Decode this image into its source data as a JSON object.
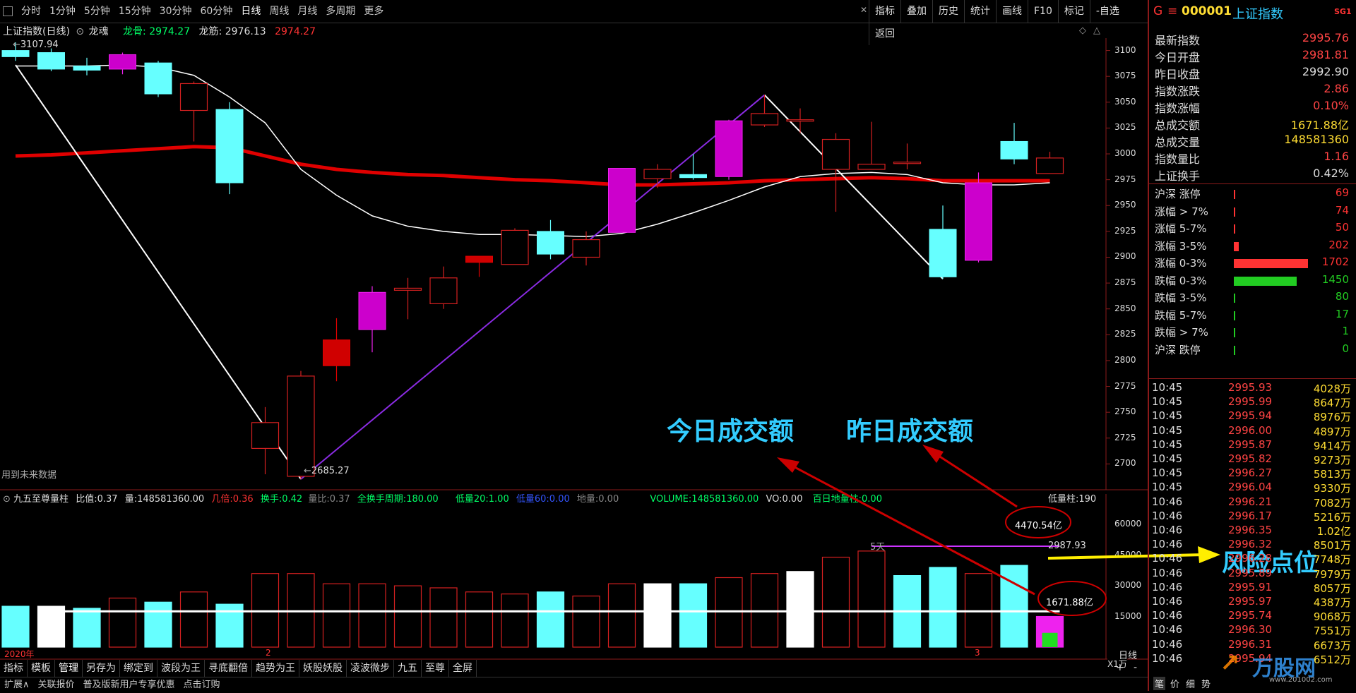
{
  "toolbar": {
    "periods": [
      "分时",
      "1分钟",
      "5分钟",
      "15分钟",
      "30分钟",
      "60分钟",
      "日线",
      "周线",
      "月线",
      "多周期",
      "更多"
    ],
    "active_period": "日线",
    "right_buttons": [
      "指标",
      "叠加",
      "历史",
      "统计",
      "画线",
      "F10",
      "标记",
      "-自选",
      "返回"
    ]
  },
  "chart_header": {
    "name": "上证指数(日线)",
    "indicator": "龙魂",
    "longgu_label": "龙骨",
    "longgu_value": "2974.27",
    "longjin_label": "龙筋",
    "longjin_value": "2976.13",
    "extra_value": "2974.27",
    "high_label": "3107.94",
    "low_label": "2685.27",
    "future_note": "用到未来数据"
  },
  "y_axis_top": [
    "3100",
    "3075",
    "3050",
    "3025",
    "3000",
    "2975",
    "2950",
    "2925",
    "2900",
    "2875",
    "2850",
    "2825",
    "2800",
    "2775",
    "2750",
    "2725",
    "2700"
  ],
  "sub_header": {
    "name": "九五至尊量柱",
    "ratio_label": "比值:",
    "ratio_value": "0.37",
    "vol_label": "量:",
    "vol_value": "148581360.00",
    "jibei_label": "几倍:",
    "jibei_value": "0.36",
    "huanshou_label": "换手:",
    "huanshou_value": "0.42",
    "liangbi_label": "量比:",
    "liangbi_value": "0.37",
    "qhs_label": "全换手周期:",
    "qhs_value": "180.00",
    "dl20_label": "低量20:",
    "dl20_value": "1.00",
    "dl60_label": "低量60:",
    "dl60_value": "0.00",
    "diliang_label": "地量:",
    "diliang_value": "0.00",
    "volume_label": "VOLUME:",
    "volume_value": "148581360.00",
    "vo_label": "VO:",
    "vo_value": "0.00",
    "bairi_label": "百日地量柱:",
    "bairi_value": "0.00",
    "diliangzhu_label": "低量柱:",
    "diliangzhu_value": "190"
  },
  "y_axis_sub": [
    "60000",
    "45000",
    "30000",
    "15000"
  ],
  "sub_unit": "X1万",
  "sub_annotations": {
    "five_day": "5天",
    "line_value": "2987.93",
    "yesterday_amount": "4470.54亿",
    "today_amount": "1671.88亿"
  },
  "x_axis": {
    "year": "2020年",
    "m2": "2",
    "m3": "3",
    "period_tag": "日线"
  },
  "annotations": {
    "today_amount": "今日成交额",
    "yesterday_amount": "昨日成交额",
    "risk": "风险点位"
  },
  "bottom_tabs": [
    "指标",
    "模板",
    "管理",
    "另存为",
    "绑定到",
    "波段为王",
    "寻底翻倍",
    "趋势为王",
    "妖股妖股",
    "凌波微步",
    "九五",
    "至尊",
    "全屏"
  ],
  "status_bar": [
    "扩展∧",
    "关联报价",
    "普及版新用户专享优惠",
    "点击订购"
  ],
  "quote": {
    "market": "G",
    "code": "000001",
    "name": "上证指数",
    "badge": "SG1",
    "rows": [
      {
        "label": "最新指数",
        "value": "2995.76",
        "color": "#ff4444"
      },
      {
        "label": "今日开盘",
        "value": "2981.81",
        "color": "#ff4444"
      },
      {
        "label": "昨日收盘",
        "value": "2992.90",
        "color": "#dddddd"
      },
      {
        "label": "指数涨跌",
        "value": "2.86",
        "color": "#ff4444"
      },
      {
        "label": "指数涨幅",
        "value": "0.10%",
        "color": "#ff4444"
      },
      {
        "label": "总成交额",
        "value": "1671.88亿",
        "color": "#ffdd33"
      },
      {
        "label": "总成交量",
        "value": "148581360",
        "color": "#ffdd33"
      },
      {
        "label": "指数量比",
        "value": "1.16",
        "color": "#ff4444"
      },
      {
        "label": "上证换手",
        "value": "0.42%",
        "color": "#dddddd"
      }
    ]
  },
  "breadth": [
    {
      "label": "沪深 涨停",
      "count": "69",
      "fill": 0.02,
      "color": "#ff3333"
    },
    {
      "label": "涨幅 > 7%",
      "count": "74",
      "fill": 0.02,
      "color": "#ff3333"
    },
    {
      "label": "涨幅 5-7%",
      "count": "50",
      "fill": 0.015,
      "color": "#ff3333"
    },
    {
      "label": "涨幅 3-5%",
      "count": "202",
      "fill": 0.07,
      "color": "#ff3333"
    },
    {
      "label": "涨幅 0-3%",
      "count": "1702",
      "fill": 1.0,
      "color": "#ff3333"
    },
    {
      "label": "跌幅 0-3%",
      "count": "1450",
      "fill": 0.85,
      "color": "#22cc22"
    },
    {
      "label": "跌幅 3-5%",
      "count": "80",
      "fill": 0.02,
      "color": "#22cc22"
    },
    {
      "label": "跌幅 5-7%",
      "count": "17",
      "fill": 0.005,
      "color": "#22cc22"
    },
    {
      "label": "跌幅 > 7%",
      "count": "1",
      "fill": 0.002,
      "color": "#22cc22"
    },
    {
      "label": "沪深 跌停",
      "count": "0",
      "fill": 0.0,
      "color": "#22cc22"
    }
  ],
  "ticks": [
    {
      "time": "10:45",
      "price": "2995.93",
      "vol": "4028万"
    },
    {
      "time": "10:45",
      "price": "2995.99",
      "vol": "8647万"
    },
    {
      "time": "10:45",
      "price": "2995.94",
      "vol": "8976万"
    },
    {
      "time": "10:45",
      "price": "2996.00",
      "vol": "4897万"
    },
    {
      "time": "10:45",
      "price": "2995.87",
      "vol": "9414万"
    },
    {
      "time": "10:45",
      "price": "2995.82",
      "vol": "9273万"
    },
    {
      "time": "10:45",
      "price": "2996.27",
      "vol": "5813万"
    },
    {
      "time": "10:45",
      "price": "2996.04",
      "vol": "9330万"
    },
    {
      "time": "10:46",
      "price": "2996.21",
      "vol": "7082万"
    },
    {
      "time": "10:46",
      "price": "2996.17",
      "vol": "5216万"
    },
    {
      "time": "10:46",
      "price": "2996.35",
      "vol": "1.02亿"
    },
    {
      "time": "10:46",
      "price": "2996.32",
      "vol": "8501万"
    },
    {
      "time": "10:46",
      "price": "2996.28",
      "vol": "7748万"
    },
    {
      "time": "10:46",
      "price": "2995.89",
      "vol": "7979万"
    },
    {
      "time": "10:46",
      "price": "2995.91",
      "vol": "8057万"
    },
    {
      "time": "10:46",
      "price": "2995.97",
      "vol": "4387万"
    },
    {
      "time": "10:46",
      "price": "2995.74",
      "vol": "9068万"
    },
    {
      "time": "10:46",
      "price": "2996.30",
      "vol": "7551万"
    },
    {
      "time": "10:46",
      "price": "2996.31",
      "vol": "6673万"
    },
    {
      "time": "10:46",
      "price": "2995.94",
      "vol": "6512万"
    }
  ],
  "watermark": "万股网",
  "watermark_url": "www.201002.com",
  "corner_tabs": [
    "笔",
    "价",
    "细",
    "势"
  ],
  "chart_data": {
    "type": "candlestick",
    "candles": [
      {
        "o": 3100,
        "h": 3107.94,
        "l": 3090,
        "c": 3094
      },
      {
        "o": 3098,
        "h": 3102,
        "l": 3080,
        "c": 3082
      },
      {
        "o": 3085,
        "h": 3093,
        "l": 3076,
        "c": 3081
      },
      {
        "o": 3082,
        "h": 3098,
        "l": 3077,
        "c": 3096
      },
      {
        "o": 3088,
        "h": 3090,
        "l": 3055,
        "c": 3058
      },
      {
        "o": 3042,
        "h": 3070,
        "l": 3012,
        "c": 3068
      },
      {
        "o": 3043,
        "h": 3050,
        "l": 2961,
        "c": 2972
      },
      {
        "o": 2740,
        "h": 2755,
        "l": 2690,
        "c": 2715
      },
      {
        "o": 2785,
        "h": 2790,
        "l": 2685.27,
        "c": 2688
      },
      {
        "o": 2795,
        "h": 2841,
        "l": 2780,
        "c": 2820
      },
      {
        "o": 2830,
        "h": 2872,
        "l": 2808,
        "c": 2866
      },
      {
        "o": 2868,
        "h": 2880,
        "l": 2840,
        "c": 2870
      },
      {
        "o": 2880,
        "h": 2891,
        "l": 2850,
        "c": 2855
      },
      {
        "o": 2895,
        "h": 2900,
        "l": 2881,
        "c": 2901
      },
      {
        "o": 2893,
        "h": 2928,
        "l": 2893,
        "c": 2926
      },
      {
        "o": 2903,
        "h": 2936,
        "l": 2898,
        "c": 2925
      },
      {
        "o": 2917,
        "h": 2925,
        "l": 2892,
        "c": 2900
      },
      {
        "o": 2924,
        "h": 2986,
        "l": 2924,
        "c": 2986
      },
      {
        "o": 2985,
        "h": 2990,
        "l": 2967,
        "c": 2976
      },
      {
        "o": 2980,
        "h": 3000,
        "l": 2975,
        "c": 2977
      },
      {
        "o": 2978,
        "h": 3033,
        "l": 2975,
        "c": 3032
      },
      {
        "o": 3039,
        "h": 3057,
        "l": 3026,
        "c": 3028
      },
      {
        "o": 3033,
        "h": 3044,
        "l": 3020,
        "c": 3033
      },
      {
        "o": 3014,
        "h": 3020,
        "l": 2944,
        "c": 2985
      },
      {
        "o": 2990,
        "h": 3031,
        "l": 2985,
        "c": 2985
      },
      {
        "o": 2992,
        "h": 3010,
        "l": 2985,
        "c": 2992
      },
      {
        "o": 2927,
        "h": 2950,
        "l": 2879,
        "c": 2881
      },
      {
        "o": 2897,
        "h": 2982,
        "l": 2895,
        "c": 2972
      },
      {
        "o": 3012,
        "h": 3030,
        "l": 2990,
        "c": 2995
      },
      {
        "o": 2981,
        "h": 3002,
        "l": 2981,
        "c": 2996
      }
    ],
    "candle_styles": [
      "cb",
      "cb",
      "cb",
      "mf",
      "cb",
      "ro",
      "cb",
      "ro",
      "ro",
      "rf",
      "mf",
      "ro",
      "ro",
      "rf",
      "ro",
      "cb",
      "ro",
      "mf",
      "ro",
      "cb",
      "mf",
      "ro",
      "ro",
      "ro",
      "ro",
      "ro",
      "cb",
      "mf",
      "cb",
      "ro"
    ],
    "ma_white": [
      3085,
      3085,
      3085,
      3086,
      3084,
      3076,
      3055,
      3030,
      2985,
      2960,
      2940,
      2930,
      2925,
      2922,
      2922,
      2921,
      2920,
      2923,
      2932,
      2943,
      2955,
      2968,
      2978,
      2981,
      2982,
      2980,
      2972,
      2970,
      2970,
      2972
    ],
    "ma_red": [
      2998,
      2999,
      3001,
      3003,
      3005,
      3007,
      3006,
      2998,
      2990,
      2985,
      2982,
      2980,
      2979,
      2977,
      2975,
      2974,
      2972,
      2970,
      2970,
      2971,
      2972,
      2974,
      2975,
      2976,
      2977,
      2976,
      2974,
      2974,
      2974,
      2974
    ],
    "zigzag": [
      [
        0,
        3086
      ],
      [
        8,
        2685.27
      ],
      [
        21,
        3057
      ],
      [
        26,
        2879
      ]
    ],
    "volumes": [
      20000,
      20000,
      19000,
      24000,
      22000,
      27000,
      21000,
      36000,
      36000,
      31000,
      31000,
      30000,
      29000,
      27000,
      26000,
      27000,
      25000,
      31000,
      31000,
      31000,
      34000,
      36000,
      37000,
      44000,
      47000,
      35000,
      39000,
      36000,
      40000,
      15000
    ],
    "volume_styles": [
      "c",
      "w",
      "c",
      "ro",
      "c",
      "ro",
      "c",
      "ro",
      "ro",
      "ro",
      "ro",
      "ro",
      "ro",
      "ro",
      "ro",
      "c",
      "ro",
      "ro",
      "w",
      "c",
      "ro",
      "ro",
      "w",
      "ro",
      "ro",
      "c",
      "c",
      "ro",
      "c",
      "m"
    ],
    "volume_extra_green": 7000,
    "ylim_price": [
      2675,
      3112
    ],
    "ylim_volume": [
      0,
      68000
    ],
    "hline_volume": 17500,
    "hline_value": 2987.93
  }
}
